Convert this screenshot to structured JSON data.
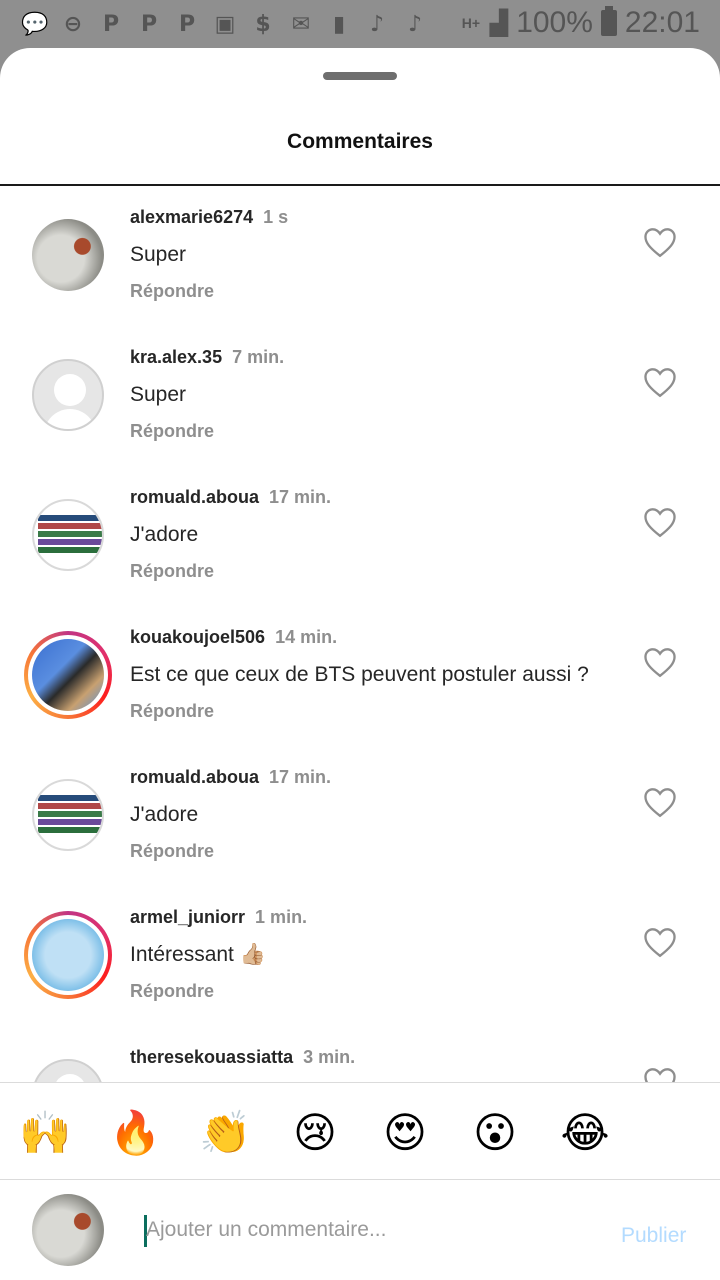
{
  "status_bar": {
    "battery": "100%",
    "time": "22:01",
    "network": "H+"
  },
  "sheet": {
    "title": "Commentaires"
  },
  "comments": [
    {
      "username": "alexmarie6274",
      "time": "1 s",
      "text": "Super",
      "reply": "Répondre",
      "avatar": "bird-photo",
      "story_ring": false
    },
    {
      "username": "kra.alex.35",
      "time": "7 min.",
      "text": "Super",
      "reply": "Répondre",
      "avatar": "default-avatar",
      "story_ring": false
    },
    {
      "username": "romuald.aboua",
      "time": "17 min.",
      "text": "J'adore",
      "reply": "Répondre",
      "avatar": "screenshot-photo",
      "story_ring": false
    },
    {
      "username": "kouakoujoel506",
      "time": "14 min.",
      "text": "Est ce que ceux de BTS peuvent postuler aussi ?",
      "reply": "Répondre",
      "avatar": "people-photo",
      "story_ring": true
    },
    {
      "username": "romuald.aboua",
      "time": "17 min.",
      "text": "J'adore",
      "reply": "Répondre",
      "avatar": "screenshot-photo",
      "story_ring": false
    },
    {
      "username": "armel_juniorr",
      "time": "1 min.",
      "text": "Intéressant 👍🏼",
      "reply": "Répondre",
      "avatar": "blue-graphic",
      "story_ring": true
    },
    {
      "username": "theresekouassiatta",
      "time": "3 min.",
      "text": "",
      "reply": "",
      "avatar": "default-avatar",
      "story_ring": false
    }
  ],
  "emoji_bar": [
    "🙌",
    "🔥",
    "👏",
    "😢",
    "😍",
    "😮",
    "😂"
  ],
  "composer": {
    "placeholder": "Ajouter un commentaire...",
    "publish_label": "Publier"
  },
  "colors": {
    "accent_disabled": "#b3dbff",
    "text_primary": "#262626",
    "text_secondary": "#8e8e8e"
  }
}
